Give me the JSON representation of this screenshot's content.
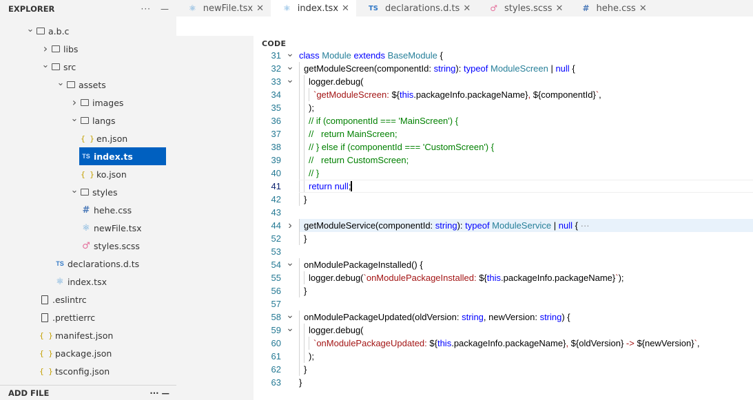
{
  "explorer": {
    "title": "EXPLORER",
    "actions_label": "···",
    "minimize_label": "—",
    "tree": [
      {
        "label": "a.b.c",
        "kind": "folder",
        "depth": 0,
        "expanded": true
      },
      {
        "label": "libs",
        "kind": "folder",
        "depth": 1,
        "expanded": false
      },
      {
        "label": "src",
        "kind": "folder",
        "depth": 1,
        "expanded": true
      },
      {
        "label": "assets",
        "kind": "folder",
        "depth": 2,
        "expanded": true
      },
      {
        "label": "images",
        "kind": "folder",
        "depth": 3,
        "expanded": false
      },
      {
        "label": "langs",
        "kind": "folder",
        "depth": 3,
        "expanded": true
      },
      {
        "label": "en.json",
        "kind": "json",
        "depth": 4
      },
      {
        "label": "index.ts",
        "kind": "ts",
        "depth": 4,
        "selected": true
      },
      {
        "label": "ko.json",
        "kind": "json",
        "depth": 4
      },
      {
        "label": "styles",
        "kind": "folder",
        "depth": 3,
        "expanded": true
      },
      {
        "label": "hehe.css",
        "kind": "css",
        "depth": 4
      },
      {
        "label": "newFile.tsx",
        "kind": "react",
        "depth": 4
      },
      {
        "label": "styles.scss",
        "kind": "scss",
        "depth": 4
      },
      {
        "label": "declarations.d.ts",
        "kind": "ts",
        "depth": 2
      },
      {
        "label": "index.tsx",
        "kind": "react",
        "depth": 2
      },
      {
        "label": ".eslintrc",
        "kind": "file",
        "depth": 1
      },
      {
        "label": ".prettierrc",
        "kind": "file",
        "depth": 1
      },
      {
        "label": "manifest.json",
        "kind": "json",
        "depth": 1
      },
      {
        "label": "package.json",
        "kind": "json",
        "depth": 1
      },
      {
        "label": "tsconfig.json",
        "kind": "json",
        "depth": 1
      }
    ],
    "footer_title": "ADD FILE"
  },
  "tabs": [
    {
      "label": "newFile.tsx",
      "icon": "react-icon",
      "active": false
    },
    {
      "label": "index.tsx",
      "icon": "react-icon",
      "active": true
    },
    {
      "label": "declarations.d.ts",
      "icon": "ts-icon",
      "active": false
    },
    {
      "label": "styles.scss",
      "icon": "scss-icon",
      "active": false
    },
    {
      "label": "hehe.css",
      "icon": "css-icon",
      "active": false
    }
  ],
  "tab_close_glyph": "✕",
  "editor": {
    "section_title": "CODE",
    "lines": [
      {
        "n": "31",
        "fold": "v",
        "indent": 0,
        "segs": [
          [
            "kw",
            "class "
          ],
          [
            "ty",
            "Module "
          ],
          [
            "kw",
            "extends "
          ],
          [
            "ty",
            "BaseModule"
          ],
          [
            "tx",
            " {"
          ]
        ]
      },
      {
        "n": "32",
        "fold": "v",
        "indent": 1,
        "segs": [
          [
            "tx",
            "getModuleScreen(componentId: "
          ],
          [
            "kw",
            "string"
          ],
          [
            "tx",
            "): "
          ],
          [
            "kw",
            "typeof "
          ],
          [
            "ty",
            "ModuleScreen"
          ],
          [
            "tx",
            " | "
          ],
          [
            "kw",
            "null"
          ],
          [
            "tx",
            " {"
          ]
        ]
      },
      {
        "n": "33",
        "fold": "v",
        "indent": 2,
        "segs": [
          [
            "tx",
            "logger.debug("
          ]
        ]
      },
      {
        "n": "34",
        "fold": "",
        "indent": 3,
        "segs": [
          [
            "str",
            "`getModuleScreen: "
          ],
          [
            "tx",
            "${"
          ],
          [
            "kw",
            "this"
          ],
          [
            "tx",
            ".packageInfo.packageName}"
          ],
          [
            "str",
            ", "
          ],
          [
            "tx",
            "${componentId}"
          ],
          [
            "str",
            "`"
          ],
          [
            "tx",
            ","
          ]
        ]
      },
      {
        "n": "35",
        "fold": "",
        "indent": 2,
        "segs": [
          [
            "tx",
            ");"
          ]
        ]
      },
      {
        "n": "36",
        "fold": "",
        "indent": 2,
        "segs": [
          [
            "cm",
            "// if (componentId === 'MainScreen') {"
          ]
        ]
      },
      {
        "n": "37",
        "fold": "",
        "indent": 2,
        "segs": [
          [
            "cm",
            "//   return MainScreen;"
          ]
        ]
      },
      {
        "n": "38",
        "fold": "",
        "indent": 2,
        "segs": [
          [
            "cm",
            "// } else if (componentId === 'CustomScreen') {"
          ]
        ]
      },
      {
        "n": "39",
        "fold": "",
        "indent": 2,
        "segs": [
          [
            "cm",
            "//   return CustomScreen;"
          ]
        ]
      },
      {
        "n": "40",
        "fold": "",
        "indent": 2,
        "segs": [
          [
            "cm",
            "// }"
          ]
        ]
      },
      {
        "n": "41",
        "fold": "",
        "indent": 2,
        "current": true,
        "cursor": true,
        "segs": [
          [
            "kw",
            "return "
          ],
          [
            "kw",
            "null"
          ],
          [
            "tx",
            ";"
          ]
        ]
      },
      {
        "n": "42",
        "fold": "",
        "indent": 1,
        "segs": [
          [
            "tx",
            "}"
          ]
        ]
      },
      {
        "n": "43",
        "fold": "",
        "indent": 0,
        "segs": []
      },
      {
        "n": "44",
        "fold": ">",
        "indent": 1,
        "hl": true,
        "segs": [
          [
            "tx",
            "getModuleService(componentId: "
          ],
          [
            "kw",
            "string"
          ],
          [
            "tx",
            "): "
          ],
          [
            "kw",
            "typeof "
          ],
          [
            "ty",
            "ModuleService"
          ],
          [
            "tx",
            " | "
          ],
          [
            "kw",
            "null"
          ],
          [
            "tx",
            " { "
          ],
          [
            "ellip",
            "···"
          ]
        ]
      },
      {
        "n": "52",
        "fold": "",
        "indent": 1,
        "segs": [
          [
            "tx",
            "}"
          ]
        ]
      },
      {
        "n": "53",
        "fold": "",
        "indent": 0,
        "segs": []
      },
      {
        "n": "54",
        "fold": "v",
        "indent": 1,
        "segs": [
          [
            "tx",
            "onModulePackageInstalled() {"
          ]
        ]
      },
      {
        "n": "55",
        "fold": "",
        "indent": 2,
        "segs": [
          [
            "tx",
            "logger.debug("
          ],
          [
            "str",
            "`onModulePackageInstalled: "
          ],
          [
            "tx",
            "${"
          ],
          [
            "kw",
            "this"
          ],
          [
            "tx",
            ".packageInfo.packageName}"
          ],
          [
            "str",
            "`"
          ],
          [
            "tx",
            ");"
          ]
        ]
      },
      {
        "n": "56",
        "fold": "",
        "indent": 1,
        "segs": [
          [
            "tx",
            "}"
          ]
        ]
      },
      {
        "n": "57",
        "fold": "",
        "indent": 0,
        "segs": []
      },
      {
        "n": "58",
        "fold": "v",
        "indent": 1,
        "segs": [
          [
            "tx",
            "onModulePackageUpdated(oldVersion: "
          ],
          [
            "kw",
            "string"
          ],
          [
            "tx",
            ", newVersion: "
          ],
          [
            "kw",
            "string"
          ],
          [
            "tx",
            ") {"
          ]
        ]
      },
      {
        "n": "59",
        "fold": "v",
        "indent": 2,
        "segs": [
          [
            "tx",
            "logger.debug("
          ]
        ]
      },
      {
        "n": "60",
        "fold": "",
        "indent": 3,
        "segs": [
          [
            "str",
            "`onModulePackageUpdated: "
          ],
          [
            "tx",
            "${"
          ],
          [
            "kw",
            "this"
          ],
          [
            "tx",
            ".packageInfo.packageName}"
          ],
          [
            "str",
            ", "
          ],
          [
            "tx",
            "${oldVersion}"
          ],
          [
            "str",
            " -> "
          ],
          [
            "tx",
            "${newVersion}"
          ],
          [
            "str",
            "`"
          ],
          [
            "tx",
            ","
          ]
        ]
      },
      {
        "n": "61",
        "fold": "",
        "indent": 2,
        "segs": [
          [
            "tx",
            ");"
          ]
        ]
      },
      {
        "n": "62",
        "fold": "",
        "indent": 1,
        "segs": [
          [
            "tx",
            "}"
          ]
        ]
      },
      {
        "n": "63",
        "fold": "",
        "indent": 0,
        "segs": [
          [
            "tx",
            "}"
          ]
        ]
      }
    ]
  }
}
